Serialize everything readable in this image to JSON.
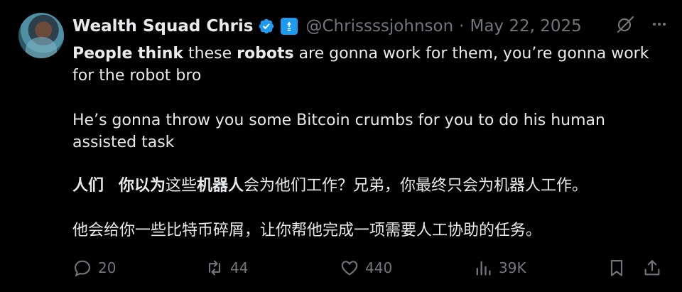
{
  "tweet": {
    "author": {
      "name": "Wealth Squad Chris",
      "handle": "@Chrissssjohnson",
      "separator": "·",
      "date": "May 22, 2025"
    },
    "header_icons": [
      "verified-badge-icon",
      "affiliate-badge-icon",
      "grok-icon",
      "more-icon"
    ],
    "text": {
      "en_p1_bold1": "People think",
      "en_p1_mid1": " these ",
      "en_p1_bold2": "robots",
      "en_p1_rest": " are gonna work for them, you’re gonna work for the robot bro",
      "en_p2": "He’s gonna throw you some Bitcoin crumbs for you to do his human assisted task",
      "zh_p1_bold1": "人们",
      "zh_p1_space": "   ",
      "zh_p1_bold2": "你以为",
      "zh_p1_mid": "这些",
      "zh_p1_bold3": "机器人",
      "zh_p1_rest": "会为他们工作？兄弟，你最终只会为机器人工作。",
      "zh_p2": "他会给你一些比特币碎屑，让你帮他完成一项需要人工协助的任务。"
    },
    "actions": {
      "replies": "20",
      "reposts": "44",
      "likes": "440",
      "views": "39K"
    },
    "colors": {
      "background": "#000000",
      "text": "#e7e9ea",
      "muted": "#71767b",
      "verified": "#1d9bf0"
    }
  }
}
